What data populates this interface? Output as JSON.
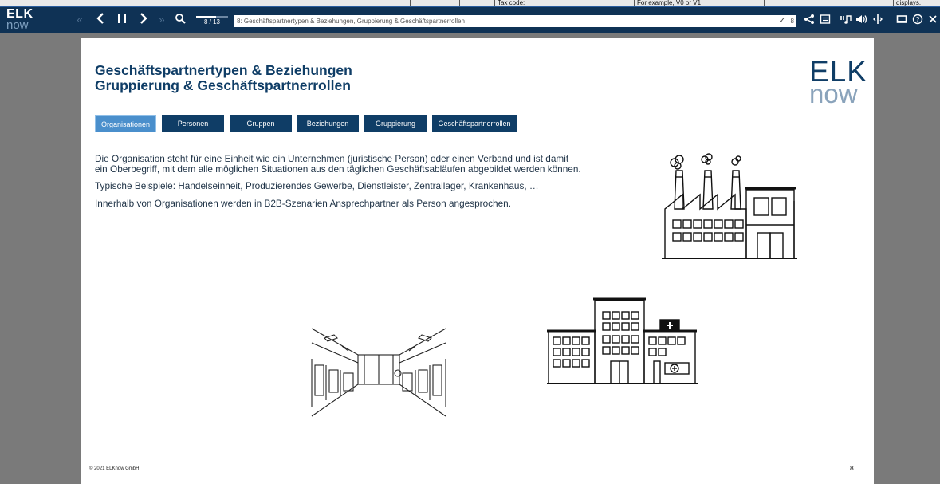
{
  "background_app": {
    "cells": [
      "Tax code:",
      "For example, V0 or V1",
      "displays."
    ]
  },
  "toolbar": {
    "logo_line1": "ELK",
    "logo_line2": "now",
    "progress_text": "8 / 13",
    "progress_fraction": 0.615,
    "slide_title": "8: Geschäftspartnertypen & Beziehungen, Gruppierung & Geschäftspartnerrollen",
    "check_mark": "✓",
    "slide_number": "8",
    "icons": [
      "double-chevron-left-icon",
      "chevron-left-icon",
      "pause-icon",
      "chevron-right-icon",
      "double-chevron-right-icon",
      "search-icon",
      "share-icon",
      "notes-icon",
      "audio-icon",
      "volume-icon",
      "split-icon",
      "screen-icon",
      "help-icon",
      "close-icon"
    ]
  },
  "slide": {
    "title_line1": "Geschäftspartnertypen & Beziehungen",
    "title_line2": "Gruppierung & Geschäftspartnerrollen",
    "logo_line1": "ELK",
    "logo_line2": "now",
    "tabs": [
      "Organisationen",
      "Personen",
      "Gruppen",
      "Beziehungen",
      "Gruppierung",
      "Geschäftspartnerrollen"
    ],
    "active_tab": "Organisationen",
    "paragraphs": [
      "Die Organisation steht für eine Einheit wie ein Unternehmen (juristische Person) oder einen Verband und ist damit ein Oberbegriff, mit dem alle möglichen Situationen aus den täglichen Geschäftsabläufen abgebildet werden können.",
      "Typische Beispiele: Handelseinheit, Produzierendes Gewerbe, Dienstleister, Zentrallager, Krankenhaus, …",
      "Innerhalb von Organisationen werden in B2B-Szenarien Ansprechpartner als Person angesprochen."
    ],
    "footer": "© 2021 ELKnow GmbH",
    "page_number": "8"
  },
  "colors": {
    "toolbar_bg": "#0f3255",
    "brand_blue": "#0f3d66",
    "tab_active": "#4a8fcc",
    "stage_bg": "#7a7a7a"
  }
}
